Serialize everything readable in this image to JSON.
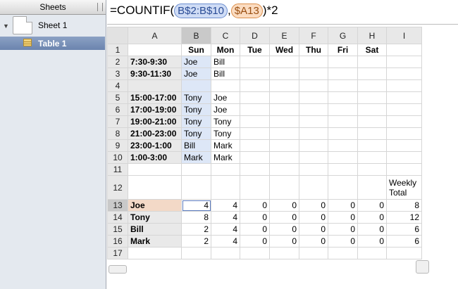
{
  "sidebar": {
    "header": "Sheets",
    "sheet": "Sheet 1",
    "table": "Table 1"
  },
  "formula": {
    "prefix": "=COUNTIF(",
    "range_token": "B$2:B$10",
    "separator": ",",
    "criteria_token": "$A13",
    "suffix": ")*2"
  },
  "grid": {
    "columns": [
      "A",
      "B",
      "C",
      "D",
      "E",
      "F",
      "G",
      "H",
      "I"
    ],
    "rows": [
      [
        "",
        "Sun",
        "Mon",
        "Tue",
        "Wed",
        "Thu",
        "Fri",
        "Sat",
        ""
      ],
      [
        "7:30-9:30",
        "Joe",
        "Bill",
        "",
        "",
        "",
        "",
        "",
        ""
      ],
      [
        "9:30-11:30",
        "Joe",
        "Bill",
        "",
        "",
        "",
        "",
        "",
        ""
      ],
      [
        "",
        "",
        "",
        "",
        "",
        "",
        "",
        "",
        ""
      ],
      [
        "15:00-17:00",
        "Tony",
        "Joe",
        "",
        "",
        "",
        "",
        "",
        ""
      ],
      [
        "17:00-19:00",
        "Tony",
        "Joe",
        "",
        "",
        "",
        "",
        "",
        ""
      ],
      [
        "19:00-21:00",
        "Tony",
        "Tony",
        "",
        "",
        "",
        "",
        "",
        ""
      ],
      [
        "21:00-23:00",
        "Tony",
        "Tony",
        "",
        "",
        "",
        "",
        "",
        ""
      ],
      [
        "23:00-1:00",
        "Bill",
        "Mark",
        "",
        "",
        "",
        "",
        "",
        ""
      ],
      [
        "1:00-3:00",
        "Mark",
        "Mark",
        "",
        "",
        "",
        "",
        "",
        ""
      ],
      [
        "",
        "",
        "",
        "",
        "",
        "",
        "",
        "",
        ""
      ],
      [
        "",
        "",
        "",
        "",
        "",
        "",
        "",
        "",
        "Weekly Total"
      ],
      [
        "Joe",
        "4",
        "4",
        "0",
        "0",
        "0",
        "0",
        "0",
        "8"
      ],
      [
        "Tony",
        "8",
        "4",
        "0",
        "0",
        "0",
        "0",
        "0",
        "12"
      ],
      [
        "Bill",
        "2",
        "4",
        "0",
        "0",
        "0",
        "0",
        "0",
        "6"
      ],
      [
        "Mark",
        "2",
        "4",
        "0",
        "0",
        "0",
        "0",
        "0",
        "6"
      ],
      [
        "",
        "",
        "",
        "",
        "",
        "",
        "",
        "",
        ""
      ]
    ]
  },
  "colors": {
    "range_highlight": "#dde7f7",
    "criteria_highlight": "#f3d9c7",
    "selection_border": "#5b7bbf"
  }
}
